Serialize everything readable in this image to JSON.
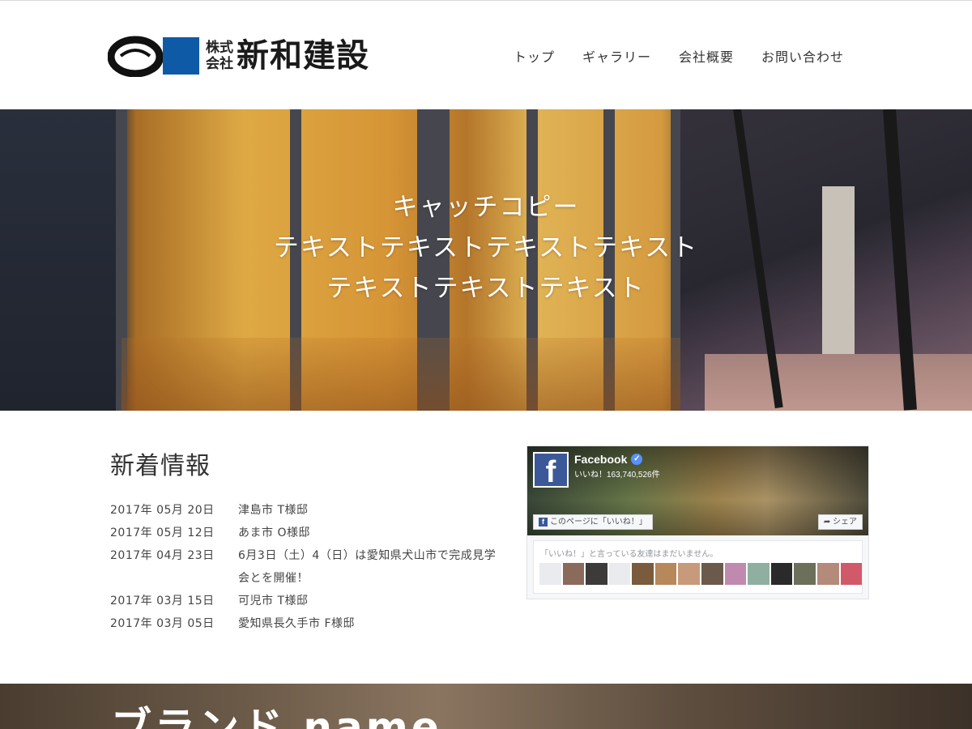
{
  "header": {
    "logo_small_top": "株式",
    "logo_small_bottom": "会社",
    "logo_name": "新和建設",
    "logo_square_color": "#0e5aa7",
    "nav": [
      {
        "label": "トップ"
      },
      {
        "label": "ギャラリー"
      },
      {
        "label": "会社概要"
      },
      {
        "label": "お問い合わせ"
      }
    ]
  },
  "hero": {
    "lines": [
      "キャッチコピー",
      "テキストテキストテキストテキスト",
      "テキストテキストテキスト"
    ]
  },
  "news": {
    "title": "新着情報",
    "items": [
      {
        "date": "2017年 05月 20日",
        "text": "津島市 T様邸"
      },
      {
        "date": "2017年 05月 12日",
        "text": "あま市 O様邸"
      },
      {
        "date": "2017年 04月 23日",
        "text": "6月3日（土）4（日）は愛知県犬山市で完成見学会とを開催！"
      },
      {
        "date": "2017年 03月 15日",
        "text": "可児市 T様邸"
      },
      {
        "date": "2017年 03月 05日",
        "text": "愛知県長久手市 F様邸"
      }
    ]
  },
  "facebook": {
    "page_name": "Facebook",
    "like_count": "いいね！163,740,526件",
    "like_button": "このページに「いいね！」",
    "share_button": "シェア",
    "friends_text": "「いいね！」と言っている友達はまだいません。",
    "brand_color": "#3b5998",
    "avatar_colors": [
      "#e9ebee",
      "#8a6a5a",
      "#3d3a3a",
      "#e9ebee",
      "#7a5b3d",
      "#b7885a",
      "#c69a7a",
      "#6b5a4c",
      "#c08ab0",
      "#8fb0a0",
      "#2a2a2a",
      "#6c6f5a",
      "#b48a7a",
      "#d05a6a"
    ]
  },
  "brand": {
    "title": "ブランド name"
  }
}
